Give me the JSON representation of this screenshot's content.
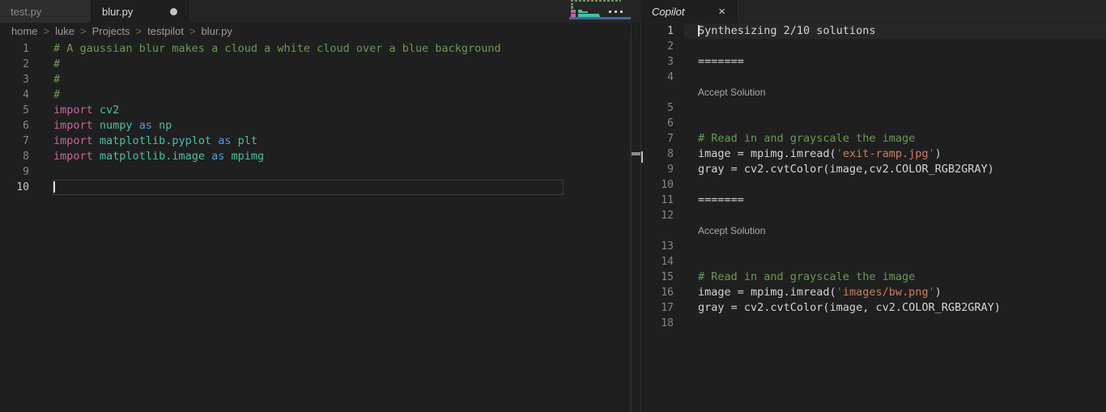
{
  "colors": {
    "editor_bg": "#1f1f1f",
    "tabbar_bg": "#252526",
    "tab_inactive_bg": "#2d2d2d",
    "tab_active_bg": "#1f1f1f",
    "text_default": "#d4d4d4",
    "comment": "#6a9955",
    "keyword_import": "#c9659b",
    "keyword_as": "#569cd6",
    "module_name": "#4bbfa5",
    "string": "#c97f63",
    "string_quote": "#9c6a4f",
    "line_number": "#858585",
    "line_number_active": "#c6c6c6",
    "breadcrumb_text": "#9b9b9b",
    "codelens_link": "#a9a9a9",
    "minimap_slider": "#3d6b99",
    "current_line_highlight": "#272727",
    "current_line_border": "#3f3f3f"
  },
  "icons": {
    "close_glyph": "×",
    "dirty_indicator": "dot",
    "more_actions": "ellipsis",
    "breadcrumb_separator": ">"
  },
  "left_group": {
    "tabs": [
      {
        "label": "test.py",
        "active": false,
        "dirty": false
      },
      {
        "label": "blur.py",
        "active": true,
        "dirty": true
      }
    ],
    "breadcrumb": [
      "home",
      "luke",
      "Projects",
      "testpilot",
      "blur.py"
    ],
    "lines": [
      {
        "n": 1,
        "t": [
          [
            "cmt",
            "# A gaussian blur makes a cloud a white cloud over a blue background"
          ]
        ]
      },
      {
        "n": 2,
        "t": [
          [
            "cmt",
            "#"
          ]
        ]
      },
      {
        "n": 3,
        "t": [
          [
            "cmt",
            "#"
          ]
        ]
      },
      {
        "n": 4,
        "t": [
          [
            "cmt",
            "#"
          ]
        ]
      },
      {
        "n": 5,
        "t": [
          [
            "kw",
            "import"
          ],
          [
            "pln",
            " "
          ],
          [
            "mod",
            "cv2"
          ]
        ]
      },
      {
        "n": 6,
        "t": [
          [
            "kw",
            "import"
          ],
          [
            "pln",
            " "
          ],
          [
            "mod",
            "numpy"
          ],
          [
            "pln",
            " "
          ],
          [
            "kw2",
            "as"
          ],
          [
            "pln",
            " "
          ],
          [
            "mod",
            "np"
          ]
        ]
      },
      {
        "n": 7,
        "t": [
          [
            "kw",
            "import"
          ],
          [
            "pln",
            " "
          ],
          [
            "mod",
            "matplotlib.pyplot"
          ],
          [
            "pln",
            " "
          ],
          [
            "kw2",
            "as"
          ],
          [
            "pln",
            " "
          ],
          [
            "mod",
            "plt"
          ]
        ]
      },
      {
        "n": 8,
        "t": [
          [
            "kw",
            "import"
          ],
          [
            "pln",
            " "
          ],
          [
            "mod",
            "matplotlib.image"
          ],
          [
            "pln",
            " "
          ],
          [
            "kw2",
            "as"
          ],
          [
            "pln",
            " "
          ],
          [
            "mod",
            "mpimg"
          ]
        ]
      },
      {
        "n": 9,
        "t": []
      },
      {
        "n": 10,
        "t": [],
        "box": true,
        "cursor": true
      }
    ]
  },
  "right_group": {
    "tab_label": "Copilot",
    "rows": [
      {
        "n": 1,
        "t": [
          [
            "pln",
            "Synthesizing 2/10 solutions"
          ]
        ],
        "current": true,
        "cursor": true
      },
      {
        "n": 2,
        "t": []
      },
      {
        "n": 3,
        "t": [
          [
            "pln",
            "======="
          ]
        ]
      },
      {
        "n": 4,
        "t": []
      },
      {
        "widget": "Accept Solution"
      },
      {
        "n": 5,
        "t": []
      },
      {
        "n": 6,
        "t": []
      },
      {
        "n": 7,
        "t": [
          [
            "cmt",
            "# Read in and grayscale the image"
          ]
        ]
      },
      {
        "n": 8,
        "t": [
          [
            "pln",
            "image = mpimg.imread("
          ],
          [
            "q",
            "'"
          ],
          [
            "str",
            "exit-ramp.jpg"
          ],
          [
            "q",
            "'"
          ],
          [
            "pln",
            ")"
          ]
        ]
      },
      {
        "n": 9,
        "t": [
          [
            "pln",
            "gray = cv2.cvtColor(image,cv2.COLOR_RGB2GRAY)"
          ]
        ]
      },
      {
        "n": 10,
        "t": []
      },
      {
        "n": 11,
        "t": [
          [
            "pln",
            "======="
          ]
        ]
      },
      {
        "n": 12,
        "t": []
      },
      {
        "widget": "Accept Solution"
      },
      {
        "n": 13,
        "t": []
      },
      {
        "n": 14,
        "t": []
      },
      {
        "n": 15,
        "t": [
          [
            "cmt",
            "# Read in and grayscale the image"
          ]
        ]
      },
      {
        "n": 16,
        "t": [
          [
            "pln",
            "image = mpimg.imread("
          ],
          [
            "q",
            "'"
          ],
          [
            "str",
            "images/bw.png"
          ],
          [
            "q",
            "'"
          ],
          [
            "pln",
            ")"
          ]
        ]
      },
      {
        "n": 17,
        "t": [
          [
            "pln",
            "gray = cv2.cvtColor(image, cv2.COLOR_RGB2GRAY)"
          ]
        ]
      },
      {
        "n": 18,
        "t": []
      }
    ]
  }
}
